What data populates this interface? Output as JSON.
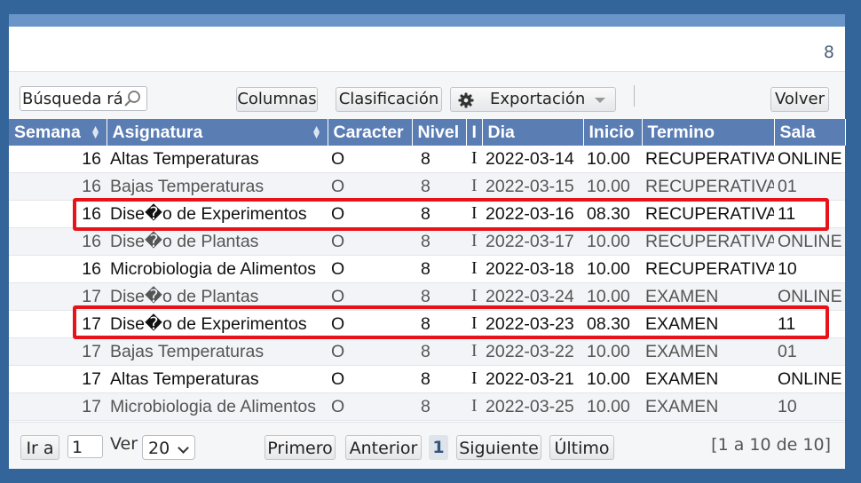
{
  "header": {
    "count": "8"
  },
  "toolbar": {
    "search_value": "Búsqueda rá",
    "columns_label": "Columnas",
    "sort_label": "Clasificación",
    "export_label": "Exportación",
    "back_label": "Volver"
  },
  "table": {
    "columns": [
      "Semana",
      "Asignatura",
      "Caracter",
      "Nivel",
      "I",
      "Dia",
      "Inicio",
      "Termino",
      "Sala"
    ],
    "rows": [
      [
        "16",
        "Altas Temperaturas",
        "O",
        "8",
        "I",
        "2022-03-14",
        "10.00",
        "RECUPERATIVA",
        "ONLINE"
      ],
      [
        "16",
        "Bajas Temperaturas",
        "O",
        "8",
        "I",
        "2022-03-15",
        "10.00",
        "RECUPERATIVA",
        "01"
      ],
      [
        "16",
        "Dise�o de Experimentos",
        "O",
        "8",
        "I",
        "2022-03-16",
        "08.30",
        "RECUPERATIVA",
        "11"
      ],
      [
        "16",
        "Dise�o de Plantas",
        "O",
        "8",
        "I",
        "2022-03-17",
        "10.00",
        "RECUPERATIVA",
        "ONLINE"
      ],
      [
        "16",
        "Microbiologia de Alimentos",
        "O",
        "8",
        "I",
        "2022-03-18",
        "10.00",
        "RECUPERATIVA",
        "10"
      ],
      [
        "17",
        "Dise�o de Plantas",
        "O",
        "8",
        "I",
        "2022-03-24",
        "10.00",
        "EXAMEN",
        "ONLINE"
      ],
      [
        "17",
        "Dise�o de Experimentos",
        "O",
        "8",
        "I",
        "2022-03-23",
        "08.30",
        "EXAMEN",
        "11"
      ],
      [
        "17",
        "Bajas Temperaturas",
        "O",
        "8",
        "I",
        "2022-03-22",
        "10.00",
        "EXAMEN",
        "01"
      ],
      [
        "17",
        "Altas Temperaturas",
        "O",
        "8",
        "I",
        "2022-03-21",
        "10.00",
        "EXAMEN",
        "ONLINE"
      ],
      [
        "17",
        "Microbiologia de Alimentos",
        "O",
        "8",
        "I",
        "2022-03-25",
        "10.00",
        "EXAMEN",
        "10"
      ]
    ],
    "highlighted_rows": [
      2,
      6
    ],
    "highlight_color": "#e8131a"
  },
  "footer": {
    "goto_label": "Ir a",
    "goto_value": "1",
    "view_label": "Ver",
    "page_size": "20",
    "first_label": "Primero",
    "prev_label": "Anterior",
    "current_page": "1",
    "next_label": "Siguiente",
    "last_label": "Último",
    "range_text": "[1 a 10 de 10]"
  },
  "colors": {
    "background": "#33659a",
    "header_bg": "#5a7db4",
    "row_alt_bg": "#f2f4f7"
  }
}
